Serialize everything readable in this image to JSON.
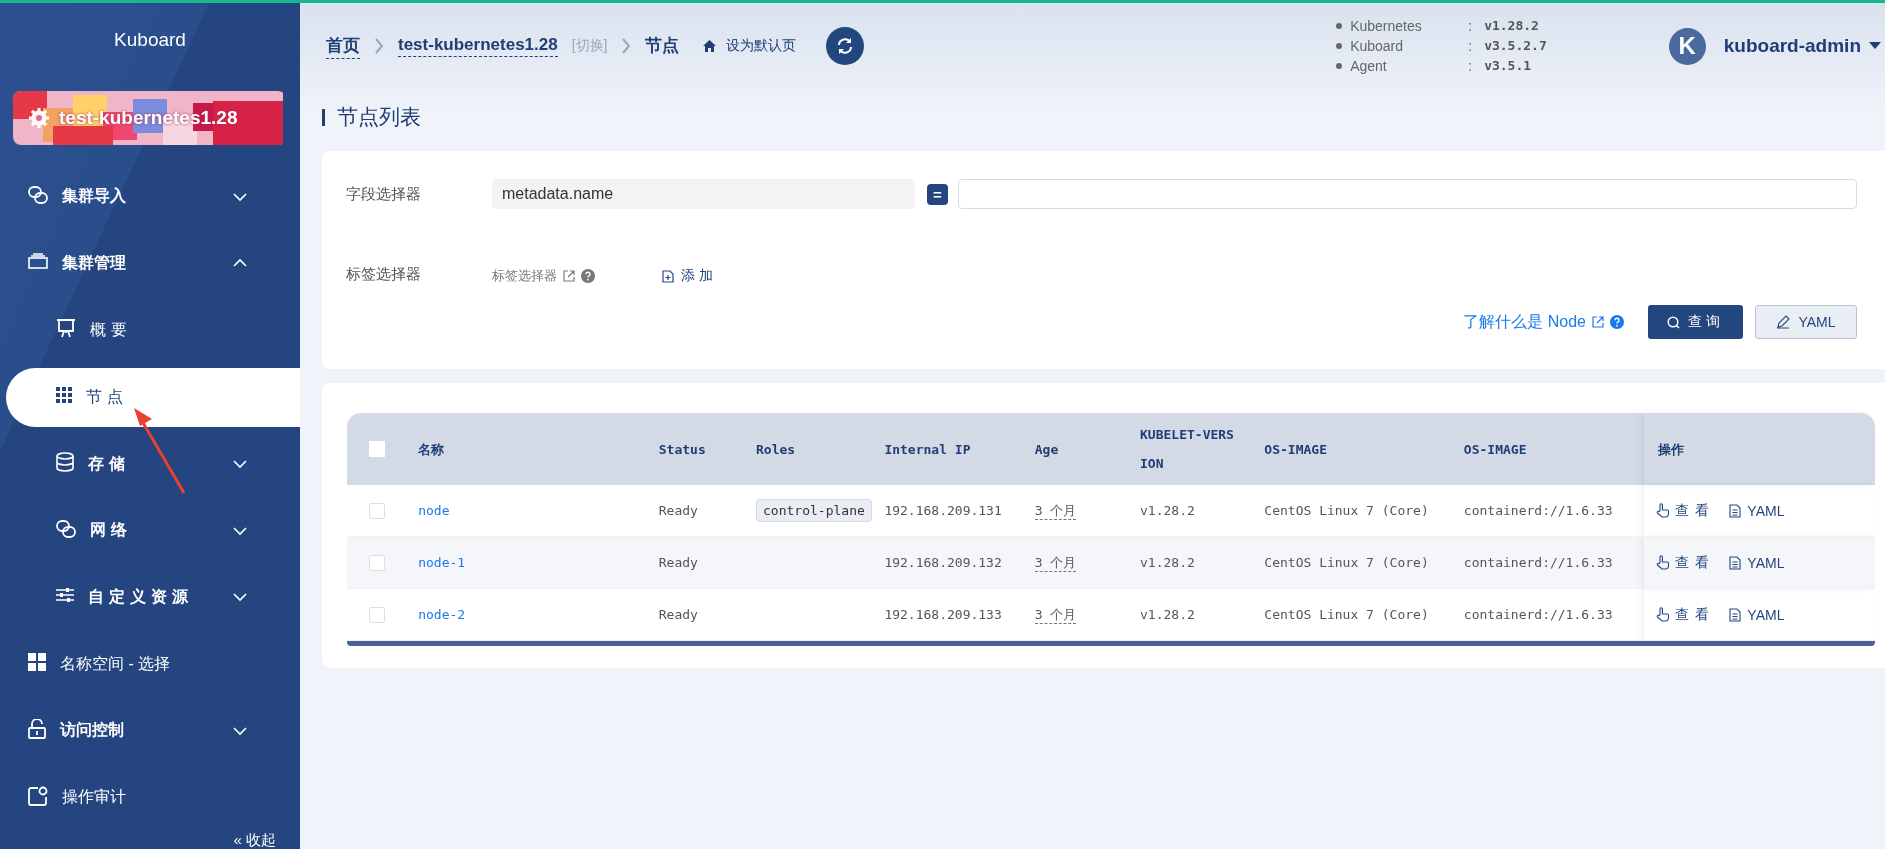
{
  "sidebar": {
    "logo": "Kuboard",
    "cluster": {
      "name": "test-kubernetes1.28"
    },
    "items": [
      {
        "label": "集群导入",
        "expanded": false
      },
      {
        "label": "集群管理",
        "expanded": true,
        "children": [
          {
            "label": "概要",
            "selected": false
          },
          {
            "label": "节点",
            "selected": true
          },
          {
            "label": "存储",
            "expanded": false
          },
          {
            "label": "网络",
            "expanded": false
          },
          {
            "label": "自定义资源",
            "expanded": false
          }
        ]
      },
      {
        "label": "名称空间 - 选择",
        "selected": false
      },
      {
        "label": "访问控制",
        "expanded": false
      },
      {
        "label": "操作审计",
        "selected": false
      }
    ],
    "collapse": "« 收起"
  },
  "header": {
    "breadcrumb": [
      {
        "label": "首页"
      },
      {
        "label": "test-kubernetes1.28",
        "action": "[切换]"
      },
      {
        "label": "节点"
      }
    ],
    "set_default": "设为默认页",
    "versions": [
      {
        "label": "Kubernetes",
        "separator": ":",
        "value": "v1.28.2"
      },
      {
        "label": "Kuboard",
        "separator": ":",
        "value": "v3.5.2.7"
      },
      {
        "label": "Agent",
        "separator": ":",
        "value": "v3.5.1"
      }
    ],
    "user": {
      "initial": "K",
      "name": "kuboard-admin"
    }
  },
  "page_title": "节点列表",
  "filter": {
    "field_selector": {
      "label": "字段选择器",
      "key": "metadata.name",
      "operator": "="
    },
    "label_selector": {
      "label": "标签选择器",
      "link": "标签选择器",
      "add": "添加"
    },
    "help_link": "了解什么是 Node",
    "buttons": [
      {
        "label": "查询",
        "kind": "primary"
      },
      {
        "label": "YAML",
        "kind": "default"
      }
    ]
  },
  "table": {
    "header_checked": false,
    "columns": [
      "名称",
      "Status",
      "Roles",
      "Internal IP",
      "Age",
      "KUBELET-VERSION",
      "OS-IMAGE",
      "OS-IMAGE",
      "操作"
    ],
    "rows": [
      {
        "checked": false,
        "name": "node",
        "status": "Ready",
        "roles": [
          "control-plane"
        ],
        "internal_ip": "192.168.209.131",
        "age": "3 个月",
        "kubelet_version": "v1.28.2",
        "os_image": "CentOS Linux 7 (Core)",
        "os_image_2": "containerd://1.6.33",
        "actions": [
          "查看",
          "YAML"
        ]
      },
      {
        "checked": false,
        "name": "node-1",
        "status": "Ready",
        "roles": [],
        "internal_ip": "192.168.209.132",
        "age": "3 个月",
        "kubelet_version": "v1.28.2",
        "os_image": "CentOS Linux 7 (Core)",
        "os_image_2": "containerd://1.6.33",
        "actions": [
          "查看",
          "YAML"
        ]
      },
      {
        "checked": false,
        "name": "node-2",
        "status": "Ready",
        "roles": [],
        "internal_ip": "192.168.209.133",
        "age": "3 个月",
        "kubelet_version": "v1.28.2",
        "os_image": "CentOS Linux 7 (Core)",
        "os_image_2": "containerd://1.6.33",
        "actions": [
          "查看",
          "YAML"
        ]
      }
    ]
  }
}
